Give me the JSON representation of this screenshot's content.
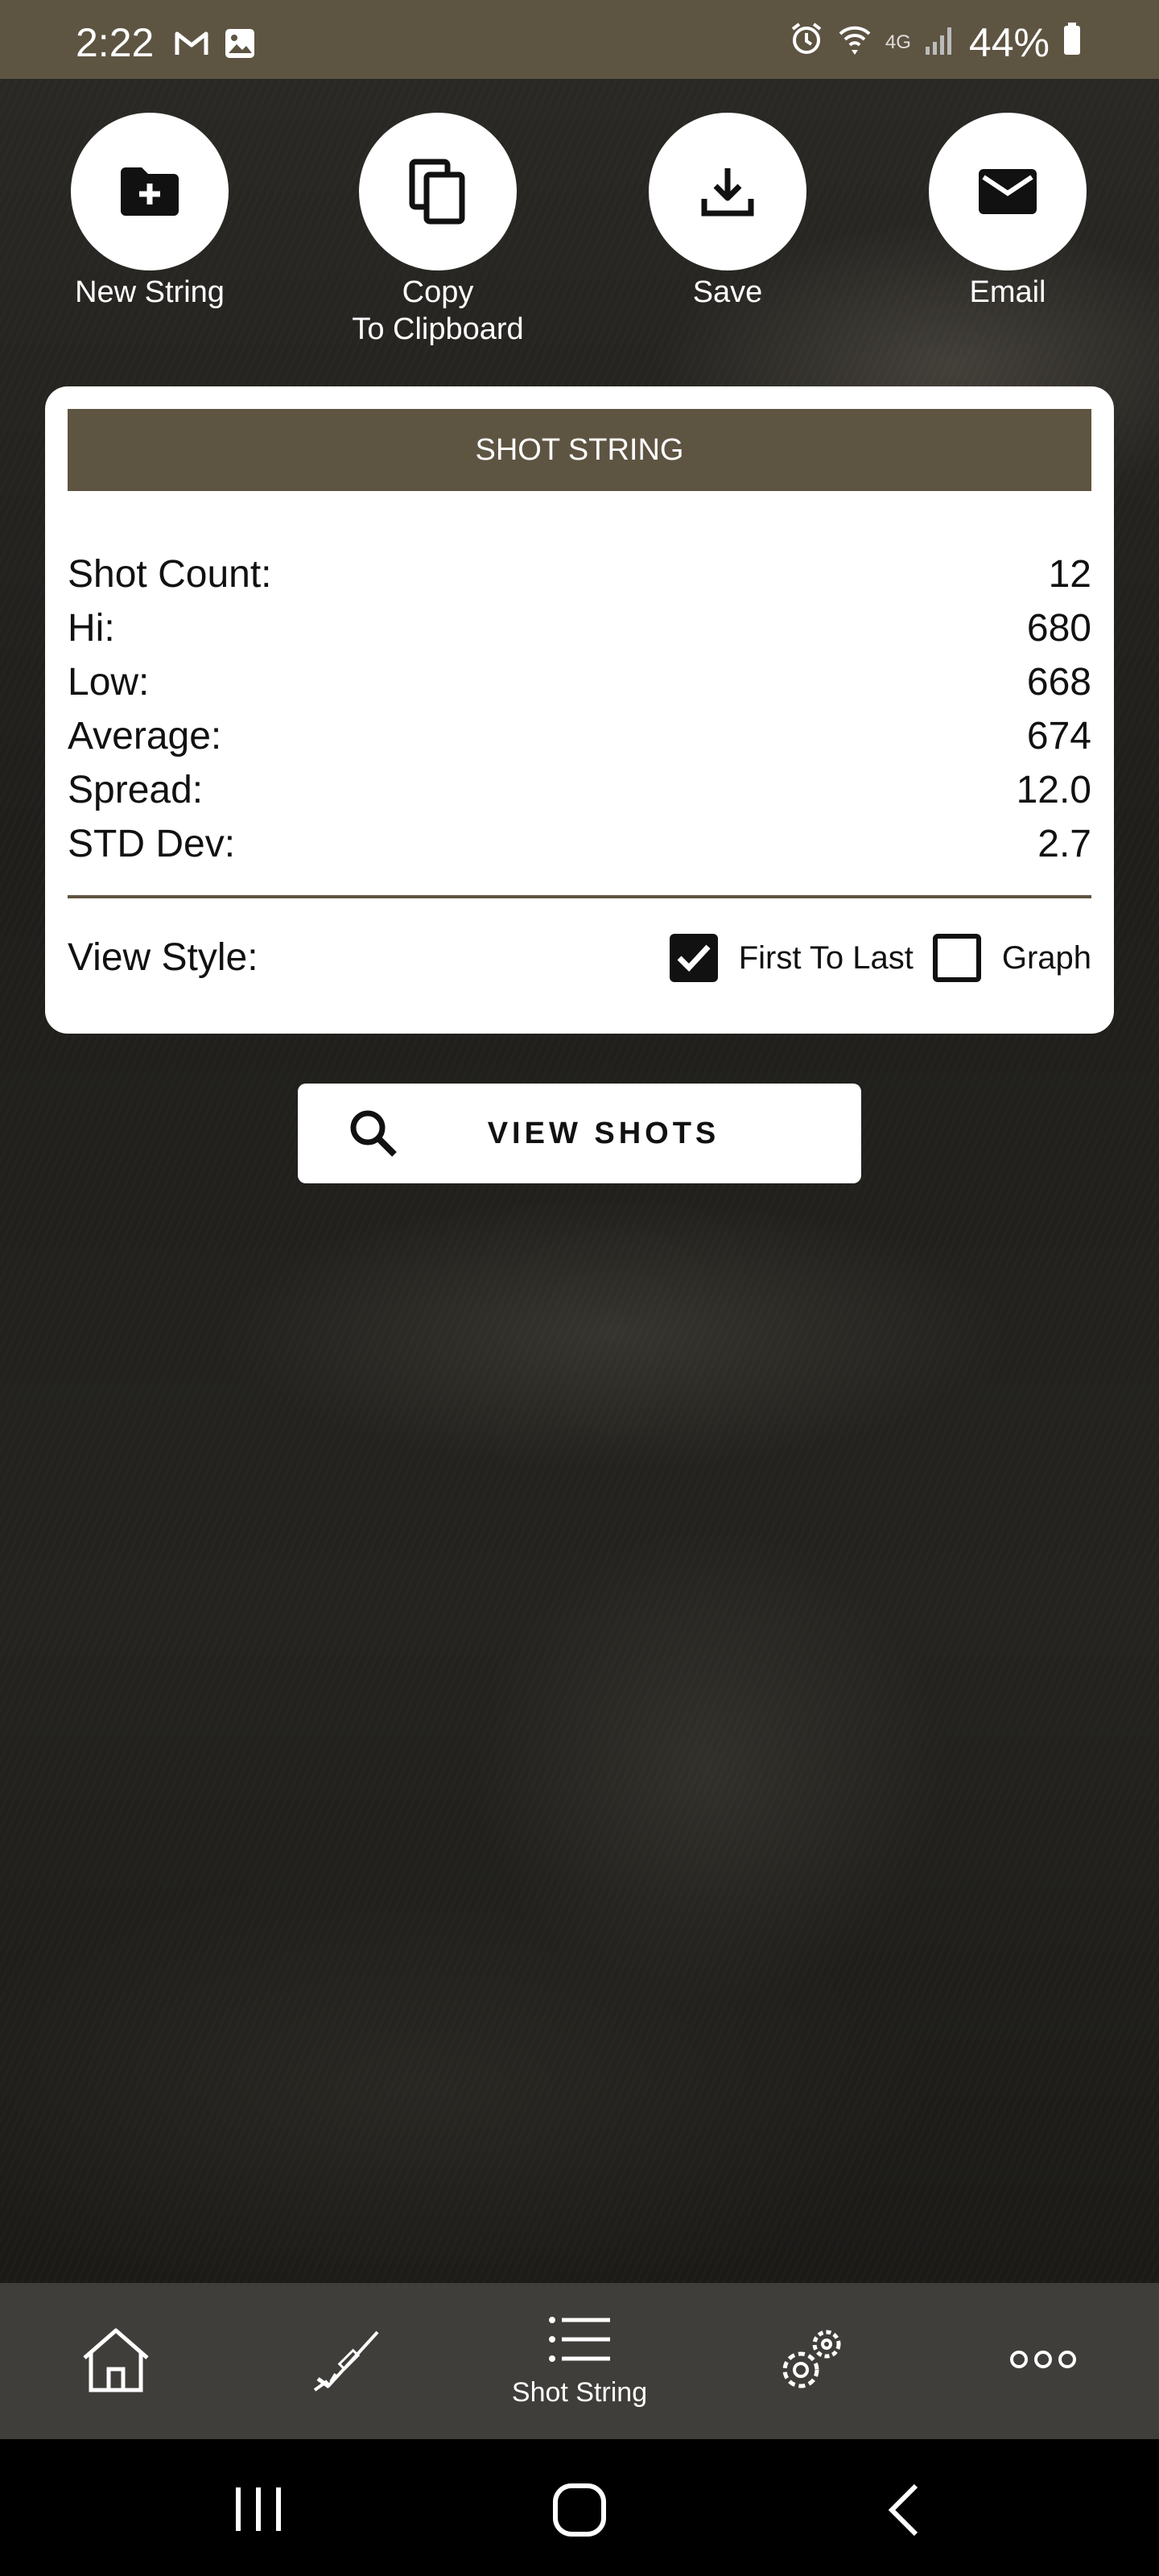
{
  "status_bar": {
    "time": "2:22",
    "battery": "44%",
    "network": "4G"
  },
  "actions": [
    {
      "label": "New String",
      "icon": "folder-add-icon"
    },
    {
      "label": "Copy\nTo Clipboard",
      "icon": "copy-icon"
    },
    {
      "label": "Save",
      "icon": "download-icon"
    },
    {
      "label": "Email",
      "icon": "mail-icon"
    }
  ],
  "card": {
    "header": "SHOT STRING",
    "stats": [
      {
        "label": "Shot Count:",
        "value": "12"
      },
      {
        "label": "Hi:",
        "value": "680"
      },
      {
        "label": "Low:",
        "value": "668"
      },
      {
        "label": "Average:",
        "value": "674"
      },
      {
        "label": "Spread:",
        "value": "12.0"
      },
      {
        "label": "STD Dev:",
        "value": "2.7"
      }
    ],
    "view_style": {
      "label": "View Style:",
      "options": [
        {
          "label": "First To Last",
          "checked": true
        },
        {
          "label": "Graph",
          "checked": false
        }
      ]
    }
  },
  "view_shots_button": "VIEW SHOTS",
  "bottom_nav": {
    "items": [
      {
        "icon": "home-icon",
        "label": ""
      },
      {
        "icon": "rifle-icon",
        "label": ""
      },
      {
        "icon": "list-icon",
        "label": "Shot String",
        "active": true
      },
      {
        "icon": "settings-icon",
        "label": ""
      },
      {
        "icon": "more-icon",
        "label": ""
      }
    ]
  },
  "colors": {
    "accent": "#5e5442",
    "nav_bg": "#3f3e3a"
  }
}
